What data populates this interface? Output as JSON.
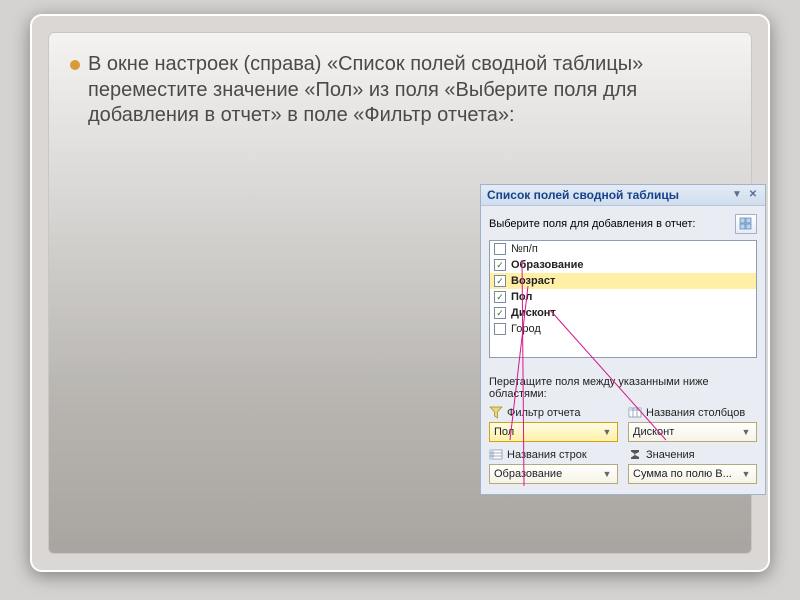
{
  "bullet_text": "В окне настроек (справа) «Список полей сводной таблицы» переместите значение «Пол» из поля «Выберите поля для добавления в отчет» в поле «Фильтр отчета»:",
  "pane": {
    "title": "Список полей сводной таблицы",
    "choose_label": "Выберите поля для добавления в отчет:",
    "fields": [
      {
        "label": "№п/п",
        "checked": false,
        "bold": false,
        "selected": false
      },
      {
        "label": "Образование",
        "checked": true,
        "bold": true,
        "selected": false
      },
      {
        "label": "Возраст",
        "checked": true,
        "bold": true,
        "selected": true
      },
      {
        "label": "Пол",
        "checked": true,
        "bold": true,
        "selected": false
      },
      {
        "label": "Дисконт",
        "checked": true,
        "bold": true,
        "selected": false
      },
      {
        "label": "Город",
        "checked": false,
        "bold": false,
        "selected": false
      }
    ],
    "drag_label": "Перетащите поля между указанными ниже областями:",
    "zones": {
      "report_filter": {
        "title": "Фильтр отчета",
        "value": "Пол"
      },
      "column_labels": {
        "title": "Названия столбцов",
        "value": "Дисконт"
      },
      "row_labels": {
        "title": "Названия строк",
        "value": "Образование"
      },
      "values": {
        "title": "Значения",
        "value": "Сумма по полю В..."
      }
    }
  }
}
